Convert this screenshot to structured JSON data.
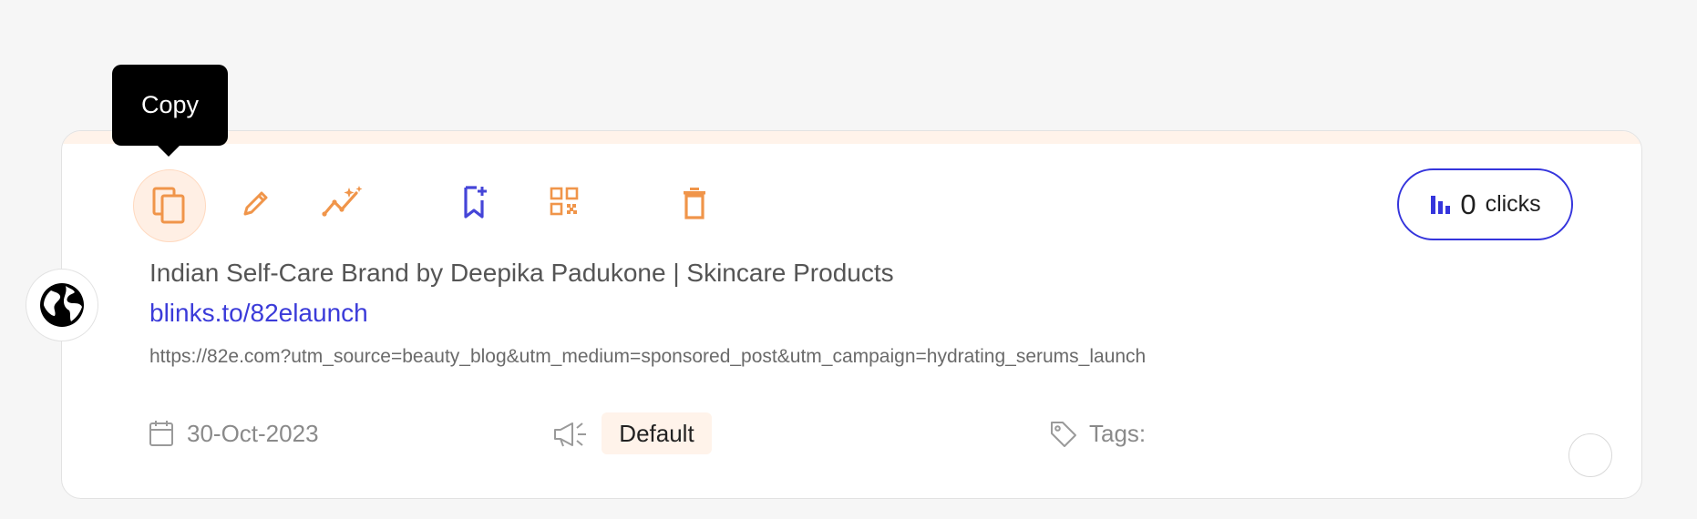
{
  "tooltip": {
    "text": "Copy"
  },
  "actions": [
    {
      "name": "copy",
      "icon": "copy-icon",
      "color": "#f0954a"
    },
    {
      "name": "edit",
      "icon": "pencil-icon",
      "color": "#f0954a"
    },
    {
      "name": "analytics",
      "icon": "sparkle-trend-icon",
      "color": "#f0954a"
    },
    {
      "name": "bookmark",
      "icon": "bookmark-add-icon",
      "color": "#4545d8"
    },
    {
      "name": "qr",
      "icon": "qr-code-icon",
      "color": "#f0954a"
    },
    {
      "name": "delete",
      "icon": "trash-icon",
      "color": "#f0954a"
    }
  ],
  "clicks": {
    "count": "0",
    "label": "clicks",
    "icon": "bar-chart-icon",
    "accent": "#3535dc"
  },
  "link": {
    "title": "Indian Self-Care Brand by Deepika Padukone | Skincare Products",
    "short_url": "blinks.to/82elaunch",
    "long_url": "https://82e.com?utm_source=beauty_blog&utm_medium=sponsored_post&utm_campaign=hydrating_serums_launch",
    "favicon": "globe-icon"
  },
  "meta": {
    "date": "30-Oct-2023",
    "campaign_icon": "megaphone-icon",
    "campaign": "Default",
    "tags_label": "Tags:",
    "tags_icon": "tag-icon",
    "date_icon": "calendar-icon"
  },
  "colors": {
    "brand_orange": "#f0954a",
    "link_blue": "#3b3bd9",
    "card_accent_bar": "#fff3ea"
  }
}
